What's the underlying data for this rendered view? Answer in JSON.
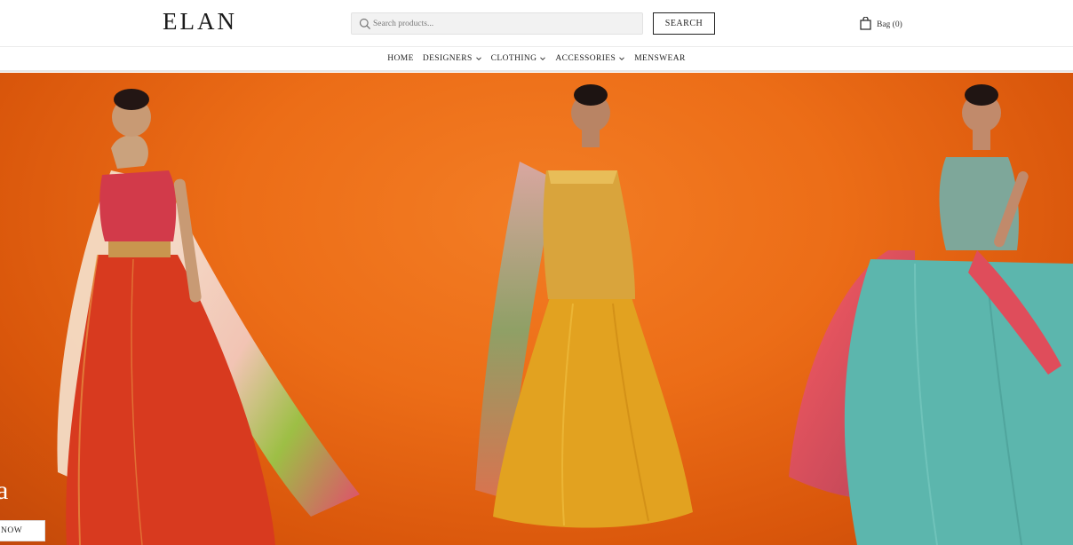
{
  "brand": {
    "logo": "ELAN"
  },
  "search": {
    "placeholder": "Search products...",
    "button_label": "SEARCH"
  },
  "bag": {
    "label": "Bag (0)"
  },
  "nav": {
    "items": [
      {
        "label": "HOME",
        "dropdown": false
      },
      {
        "label": "DESIGNERS",
        "dropdown": true
      },
      {
        "label": "CLOTHING",
        "dropdown": true
      },
      {
        "label": "ACCESSORIES",
        "dropdown": true
      },
      {
        "label": "MENSWEAR",
        "dropdown": false
      }
    ]
  },
  "hero": {
    "heading_fragment": "a",
    "cta_label": "NOW",
    "background_color": "#ec6d17"
  },
  "icons": [
    "search-icon",
    "bag-icon",
    "chevron-down-icon"
  ]
}
